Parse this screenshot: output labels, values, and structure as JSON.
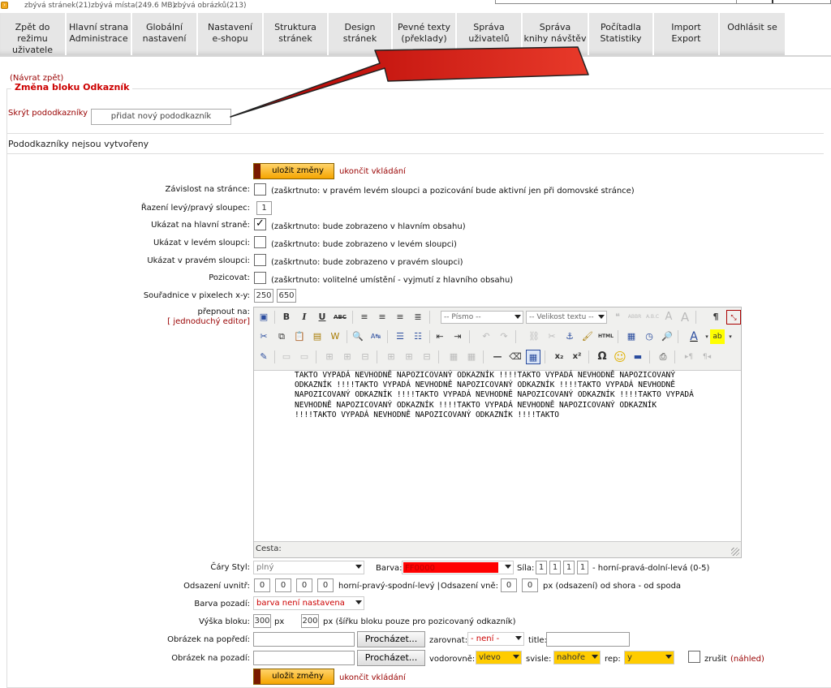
{
  "stats": {
    "icon": "arrow-icon",
    "pages_left": "zbývá stránek(21)",
    "space_left": "zbývá místa(249.6 MB)",
    "images_left": "zbývá obrázků(213)"
  },
  "nav": {
    "tabs": [
      {
        "l1": "Zpět do režimu",
        "l2": "uživatele"
      },
      {
        "l1": "Hlavní strana",
        "l2": "Administrace"
      },
      {
        "l1": "Globální",
        "l2": "nastavení"
      },
      {
        "l1": "Nastavení",
        "l2": "e-shopu"
      },
      {
        "l1": "Struktura",
        "l2": "stránek"
      },
      {
        "l1": "Design",
        "l2": "stránek"
      },
      {
        "l1": "Pevné texty",
        "l2": "(překlady)"
      },
      {
        "l1": "Správa",
        "l2": "uživatelů"
      },
      {
        "l1": "Správa",
        "l2": "knihy návštěv"
      },
      {
        "l1": "Počítadla",
        "l2": "Statistiky"
      },
      {
        "l1": "Import",
        "l2": "Export"
      },
      {
        "l1": "Odhlásit se",
        "l2": ""
      }
    ]
  },
  "page": {
    "back_link": "(Návrat zpět)",
    "legend": "Změna bloku Odkazník",
    "hide_subs": "Skrýt pododkazníky",
    "separator": "|",
    "add_sub": "přidat nový pododkazník",
    "no_subs": "Pododkazníky nejsou vytvořeny",
    "save": "uložit změny",
    "end_insert": "ukončit vkládání"
  },
  "form": {
    "dependency_label": "Závislost na stránce:",
    "dependency_note": "(zaškrtnuto: v pravém levém sloupci a pozicování bude aktivní jen při domovské stránce)",
    "order_label": "Řazení levý/pravý sloupec:",
    "order_value": "1",
    "show_main_label": "Ukázat na hlavní straně:",
    "show_main_note": "(zaškrtnuto: bude zobrazeno v hlavním obsahu)",
    "show_left_label": "Ukázat v levém sloupci:",
    "show_left_note": "(zaškrtnuto: bude zobrazeno v levém sloupci)",
    "show_right_label": "Ukázat v pravém sloupci:",
    "show_right_note": "(zaškrtnuto: bude zobrazeno v pravém sloupci)",
    "position_label": "Pozicovat:",
    "position_note": "(zaškrtnuto: volitelné umístění - vyjmutí z hlavního obsahu)",
    "coords_label": "Souřadnice v pixelech x-y:",
    "coord_x": "250",
    "coord_y": "650",
    "switch_label": "přepnout na:",
    "simple_editor": "[ jednoduchý editor]",
    "show_main_checked": true
  },
  "editor": {
    "font_select": "-- Písmo --",
    "size_select": "-- Velikost textu --",
    "content": "TAKTO VYPADÁ NEVHODNĚ NAPOZICOVANÝ ODKAZNÍK !!!!TAKTO VYPADÁ NEVHODNĚ NAPOZICOVANÝ ODKAZNÍK !!!!TAKTO VYPADÁ NEVHODNĚ NAPOZICOVANÝ ODKAZNÍK !!!!TAKTO VYPADÁ NEVHODNĚ NAPOZICOVANÝ ODKAZNÍK !!!!TAKTO VYPADÁ NEVHODNĚ NAPOZICOVANÝ ODKAZNÍK !!!!TAKTO VYPADÁ NEVHODNĚ NAPOZICOVANÝ ODKAZNÍK !!!!TAKTO VYPADÁ NEVHODNĚ NAPOZICOVANÝ ODKAZNÍK !!!!TAKTO VYPADÁ NEVHODNĚ NAPOZICOVANÝ ODKAZNÍK !!!!TAKTO",
    "path_label": "Cesta:"
  },
  "style": {
    "line_style_label": "Čáry Styl:",
    "line_style_value": "plný",
    "color_label": "Barva:",
    "color_value": "FF0000",
    "color_hex": "#ff0000",
    "width_label": "Síla:",
    "widths": [
      "1",
      "1",
      "1",
      "1"
    ],
    "width_note": "- horní-pravá-dolní-levá (0-5)",
    "padding_label": "Odsazení uvnitř:",
    "paddings": [
      "0",
      "0",
      "0",
      "0"
    ],
    "padding_note": "horní-pravý-spodní-levý |",
    "margin_label": "Odsazení vně:",
    "margins": [
      "0",
      "0"
    ],
    "margin_note": "px (odsazení) od shora - od spoda",
    "bg_color_label": "Barva pozadí:",
    "bg_color_value": "barva není nastavena",
    "height_label": "Výška bloku:",
    "height_value": "300",
    "px": "px",
    "block_width_value": "200",
    "width_hint": "px (šířku bloku pouze pro pozicovaný odkazník)",
    "fg_image_label": "Obrázek na popředí:",
    "browse": "Procházet...",
    "align_label": "zarovnat:",
    "align_value": "- není -",
    "title_label": "title:",
    "bg_image_label": "Obrázek na pozadí:",
    "horiz_label": "vodorovně:",
    "horiz_value": "vlevo",
    "vert_label": "svisle:",
    "vert_value": "nahoře",
    "rep_label": "rep:",
    "rep_value": "y",
    "cancel_label": "zrušit",
    "preview_label": "(náhled)",
    "highlight": "#ffcc00"
  }
}
